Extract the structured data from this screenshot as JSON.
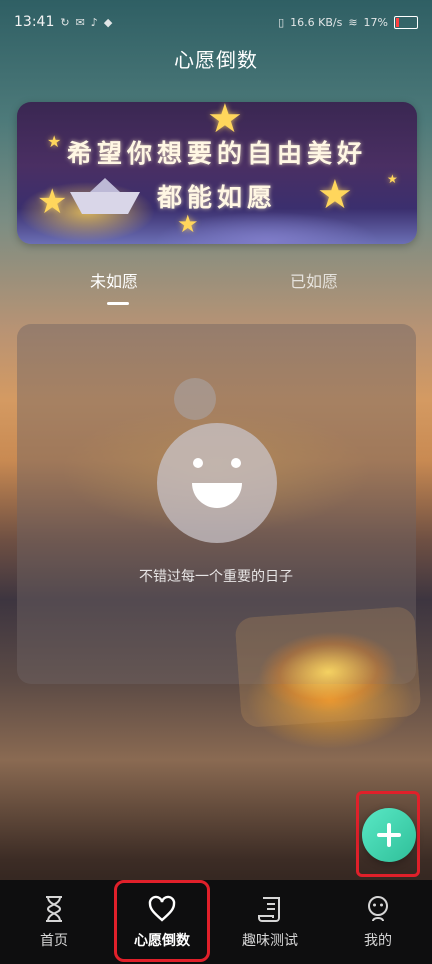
{
  "status_bar": {
    "time": "13:41",
    "network_speed": "16.6 KB/s",
    "battery": "17%"
  },
  "page": {
    "title": "心愿倒数"
  },
  "banner": {
    "line1": "希望你想要的自由美好",
    "line2": "都能如愿"
  },
  "tabs": [
    {
      "label": "未如愿",
      "active": true
    },
    {
      "label": "已如愿",
      "active": false
    }
  ],
  "empty_state": {
    "message": "不错过每一个重要的日子",
    "icon": "smiley-face-icon"
  },
  "fab": {
    "icon": "plus-icon",
    "color": "#3fd3ad"
  },
  "bottom_nav": [
    {
      "label": "首页",
      "icon": "hourglass-icon",
      "active": false
    },
    {
      "label": "心愿倒数",
      "icon": "heart-icon",
      "active": true
    },
    {
      "label": "趣味测试",
      "icon": "scroll-icon",
      "active": false
    },
    {
      "label": "我的",
      "icon": "person-icon",
      "active": false
    }
  ],
  "colors": {
    "highlight_border": "#e0202a",
    "nav_bg": "#0e0e0f"
  }
}
